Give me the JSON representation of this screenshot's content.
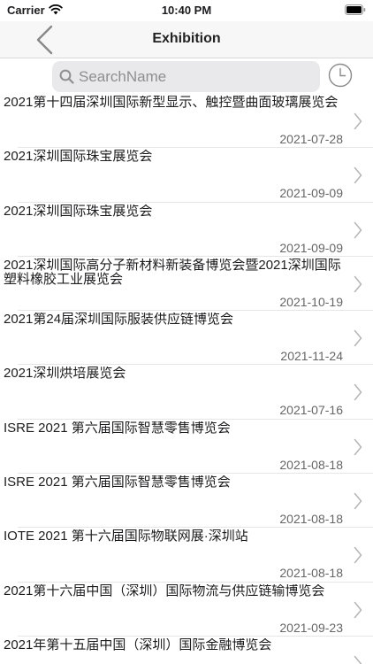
{
  "status_bar": {
    "carrier": "Carrier",
    "time": "10:40 PM"
  },
  "nav": {
    "title": "Exhibition"
  },
  "search": {
    "placeholder": "SearchName",
    "value": ""
  },
  "exhibitions": [
    {
      "title": "2021第十四届深圳国际新型显示、触控暨曲面玻璃展览会",
      "date": "2021-07-28"
    },
    {
      "title": "2021深圳国际珠宝展览会",
      "date": "2021-09-09"
    },
    {
      "title": "2021深圳国际珠宝展览会",
      "date": "2021-09-09"
    },
    {
      "title": "2021深圳国际高分子新材料新装备博览会暨2021深圳国际塑料橡胶工业展览会",
      "date": "2021-10-19"
    },
    {
      "title": "2021第24届深圳国际服装供应链博览会",
      "date": "2021-11-24"
    },
    {
      "title": "2021深圳烘培展览会",
      "date": "2021-07-16"
    },
    {
      "title": "ISRE 2021 第六届国际智慧零售博览会",
      "date": "2021-08-18"
    },
    {
      "title": "ISRE 2021 第六届国际智慧零售博览会",
      "date": "2021-08-18"
    },
    {
      "title": "IOTE 2021 第十六届国际物联网展·深圳站",
      "date": "2021-08-18"
    },
    {
      "title": "2021第十六届中国（深圳）国际物流与供应链输博览会",
      "date": "2021-09-23"
    },
    {
      "title": "2021年第十五届中国（深圳）国际金融博览会",
      "date": ""
    }
  ]
}
